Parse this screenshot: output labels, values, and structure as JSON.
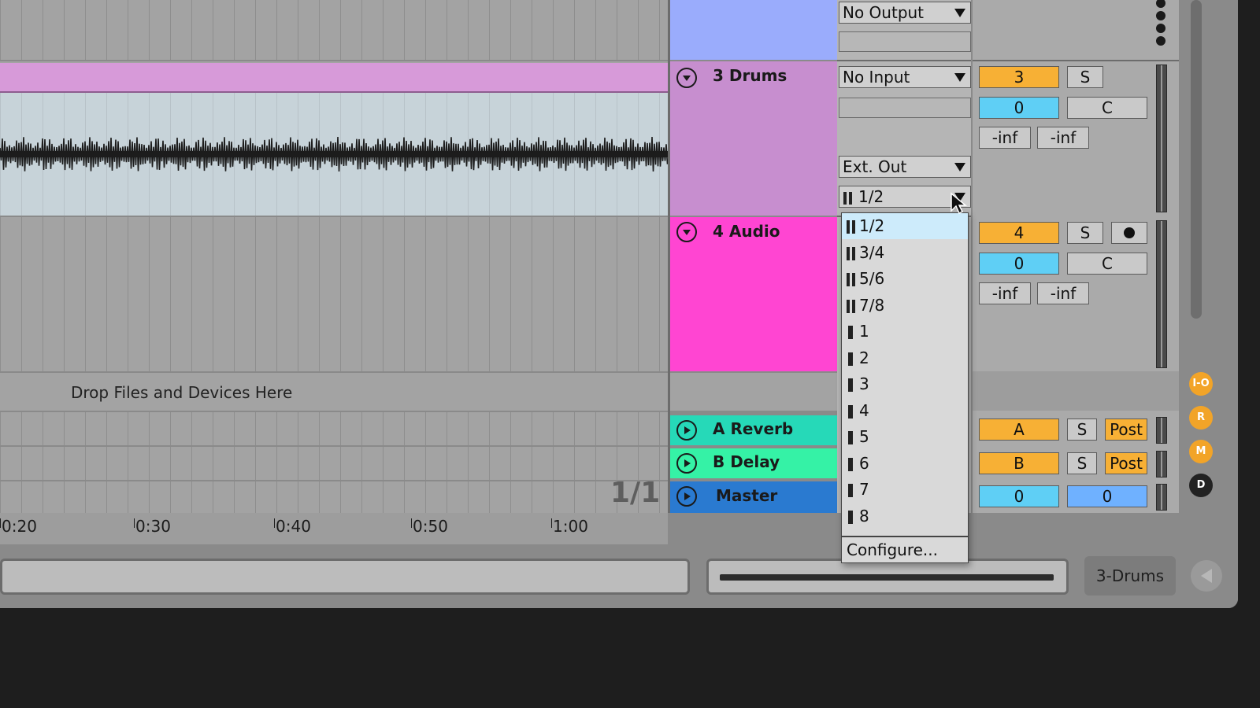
{
  "tracks": {
    "drums": {
      "name": "3 Drums",
      "input": "No Input",
      "output": "Ext. Out",
      "channel": "1/2",
      "number": "3",
      "solo": "S",
      "volume": "0",
      "pan": "C",
      "peak_l": "-inf",
      "peak_r": "-inf"
    },
    "audio": {
      "name": "4 Audio",
      "number": "4",
      "solo": "S",
      "volume": "0",
      "pan": "C",
      "peak_l": "-inf",
      "peak_r": "-inf"
    },
    "reverb": {
      "name": "A Reverb",
      "letter": "A",
      "solo": "S",
      "post": "Post"
    },
    "delay": {
      "name": "B Delay",
      "letter": "B",
      "solo": "S",
      "post": "Post"
    },
    "master": {
      "name": "Master",
      "vol1": "0",
      "vol2": "0"
    }
  },
  "top_io": {
    "output": "No Output"
  },
  "dropdown": {
    "items": [
      "1/2",
      "3/4",
      "5/6",
      "7/8",
      "1",
      "2",
      "3",
      "4",
      "5",
      "6",
      "7",
      "8"
    ],
    "selected": "1/2",
    "configure": "Configure..."
  },
  "arrangement": {
    "drop_text": "Drop Files and Devices Here",
    "ruler": [
      "0:20",
      "0:30",
      "0:40",
      "0:50",
      "1:00"
    ],
    "loop_fraction": "1/1"
  },
  "bottom": {
    "selected_track": "3-Drums"
  },
  "side_buttons": [
    "I-O",
    "R",
    "M",
    "D"
  ],
  "colors": {
    "drums": "#c78ecf",
    "audio": "#ff45d2",
    "reverb": "#26d9b8",
    "delay": "#35f2a6",
    "master": "#2a7ad0",
    "top": "#9aacfc",
    "orange": "#f7b035"
  }
}
